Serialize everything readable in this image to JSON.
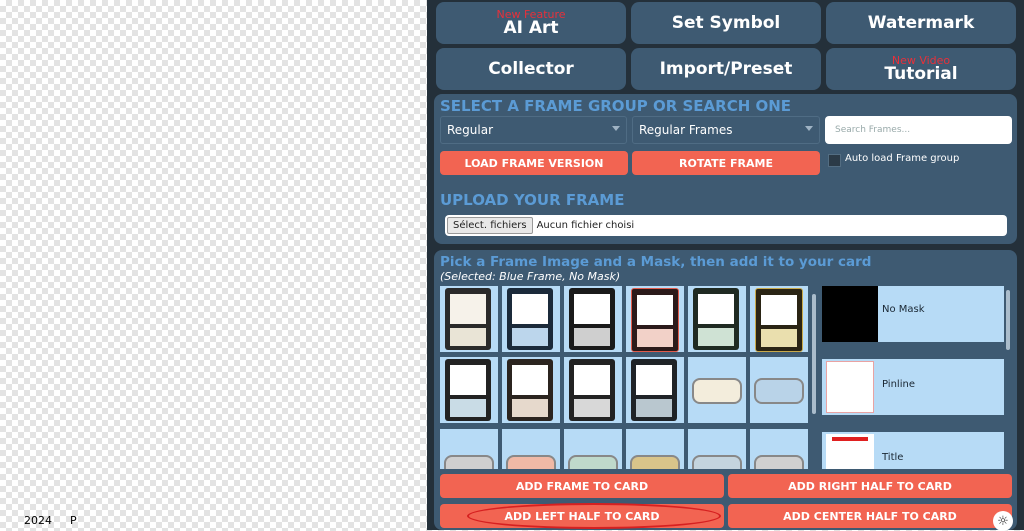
{
  "footer": {
    "year": "2024",
    "p": "P"
  },
  "tabs": [
    {
      "label": "AI Art",
      "badge": "New Feature"
    },
    {
      "label": "Set Symbol",
      "badge": ""
    },
    {
      "label": "Watermark",
      "badge": ""
    },
    {
      "label": "Collector",
      "badge": ""
    },
    {
      "label": "Import/Preset",
      "badge": ""
    },
    {
      "label": "Tutorial",
      "badge": "New Video"
    }
  ],
  "frame_group": {
    "title": "SELECT A FRAME GROUP OR SEARCH ONE",
    "group_select": "Regular",
    "frames_select": "Regular Frames",
    "search_placeholder": "Search Frames...",
    "load_button": "LOAD FRAME VERSION",
    "rotate_button": "ROTATE FRAME",
    "auto_load_label": "Auto load Frame group"
  },
  "upload": {
    "title": "UPLOAD YOUR FRAME",
    "file_button": "Sélect. fichiers",
    "file_status": "Aucun fichier choisi"
  },
  "picker": {
    "title": "Pick a Frame Image and a Mask, then add it to your card",
    "selection": "(Selected: Blue Frame, No Mask)",
    "masks": [
      "No Mask",
      "Pinline",
      "Title"
    ]
  },
  "actions": {
    "add_frame": "ADD FRAME TO CARD",
    "add_right": "ADD RIGHT HALF TO CARD",
    "add_left": "ADD LEFT HALF TO CARD",
    "add_center": "ADD CENTER HALF TO CARD"
  },
  "colors": {
    "panel": "#24303a",
    "section": "#3e5a72",
    "accent_button": "#f26452",
    "title_blue": "#5b9bd5",
    "thumb_bg": "#b7dbf6"
  }
}
